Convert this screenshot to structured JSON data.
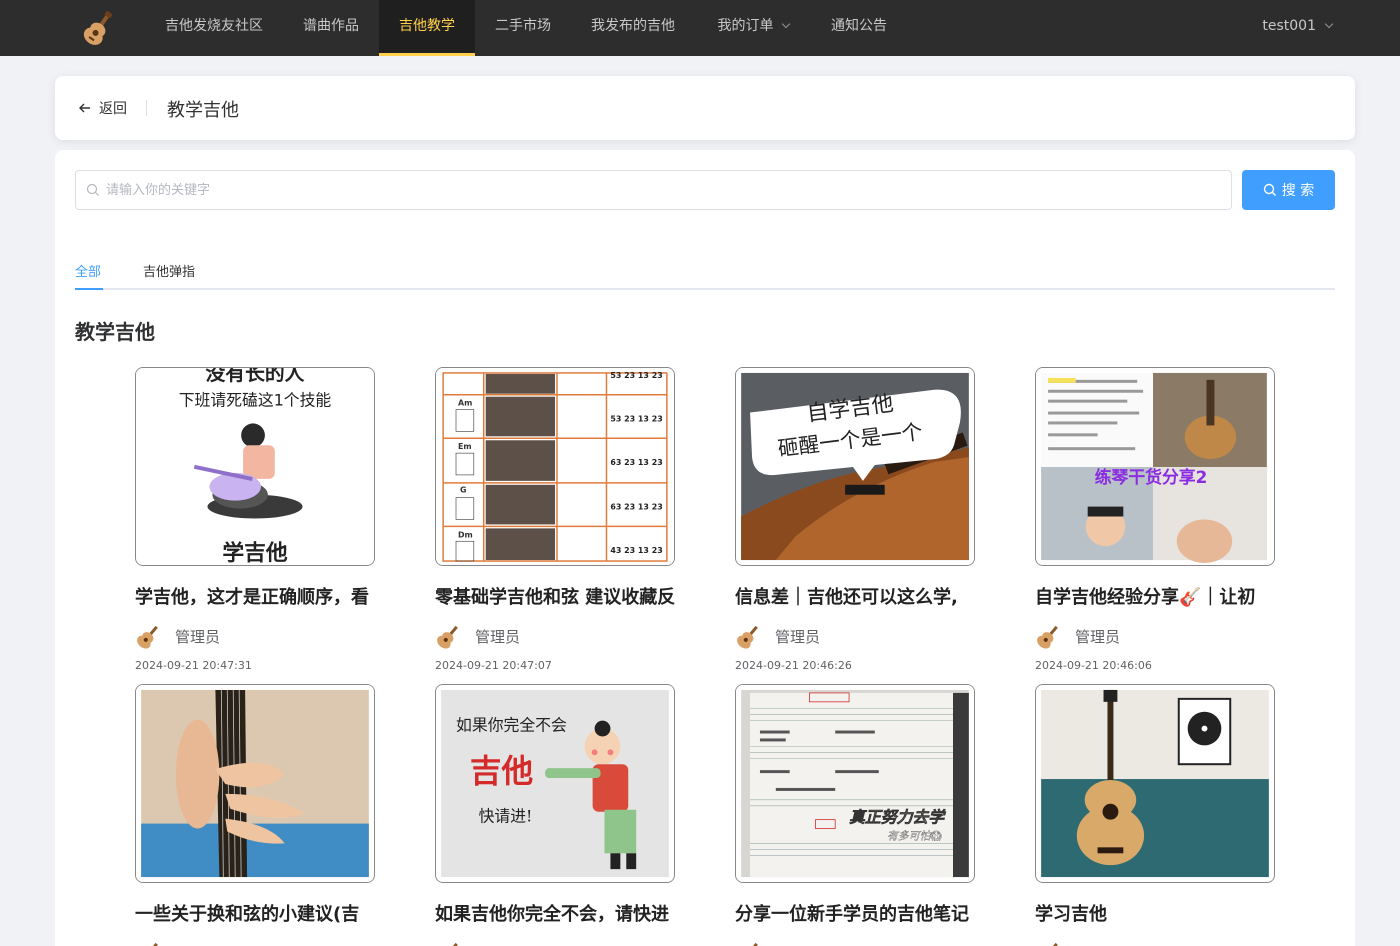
{
  "nav": {
    "items": [
      {
        "label": "吉他发烧友社区",
        "active": false,
        "dropdown": false
      },
      {
        "label": "谱曲作品",
        "active": false,
        "dropdown": false
      },
      {
        "label": "吉他教学",
        "active": true,
        "dropdown": false
      },
      {
        "label": "二手市场",
        "active": false,
        "dropdown": false
      },
      {
        "label": "我发布的吉他",
        "active": false,
        "dropdown": false
      },
      {
        "label": "我的订单",
        "active": false,
        "dropdown": true
      },
      {
        "label": "通知公告",
        "active": false,
        "dropdown": false
      }
    ],
    "user": "test001",
    "logo_icon": "guitar-logo-icon"
  },
  "header": {
    "back_label": "返回",
    "title": "教学吉他"
  },
  "search": {
    "placeholder": "请输入你的关键字",
    "button_label": "搜 索"
  },
  "tabs": [
    {
      "label": "全部",
      "active": true
    },
    {
      "label": "吉他弹指",
      "active": false
    }
  ],
  "section_title": "教学吉他",
  "cards": [
    {
      "title": "学吉他，这才是正确顺序，看",
      "author": "管理员",
      "date": "2024-09-21 20:47:31",
      "thumb_text": [
        "没有长的人",
        "下班请死磕这1个技能",
        "学吉他"
      ]
    },
    {
      "title": "零基础学吉他和弦 建议收藏反",
      "author": "管理员",
      "date": "2024-09-21 20:47:07",
      "thumb_text": [
        "Am",
        "Em",
        "G",
        "Dm",
        "53 23 13 23",
        "53 23 13 23",
        "63 23 13 23",
        "63 23 13 23",
        "43 23 13 23"
      ]
    },
    {
      "title": "信息差｜吉他还可以这么学,",
      "author": "管理员",
      "date": "2024-09-21 20:46:26",
      "thumb_text": [
        "自学吉他",
        "砸醒一个是一个"
      ]
    },
    {
      "title": "自学吉他经验分享🎸｜让初",
      "author": "管理员",
      "date": "2024-09-21 20:46:06",
      "thumb_text": [
        "练琴干货分享2"
      ]
    },
    {
      "title": "一些关于换和弦的小建议(吉",
      "author": "",
      "date": "",
      "thumb_text": []
    },
    {
      "title": "如果吉他你完全不会，请快进",
      "author": "",
      "date": "",
      "thumb_text": [
        "如果你完全不会",
        "吉他",
        "快请进!"
      ]
    },
    {
      "title": "分享一位新手学员的吉他笔记",
      "author": "",
      "date": "",
      "thumb_text": [
        "真正努力去学",
        "有多可怕😱"
      ]
    },
    {
      "title": "学习吉他",
      "author": "",
      "date": "",
      "thumb_text": []
    }
  ],
  "colors": {
    "nav_bg": "#2d2d2d",
    "nav_active": "#ffd04b",
    "primary": "#409eff"
  }
}
